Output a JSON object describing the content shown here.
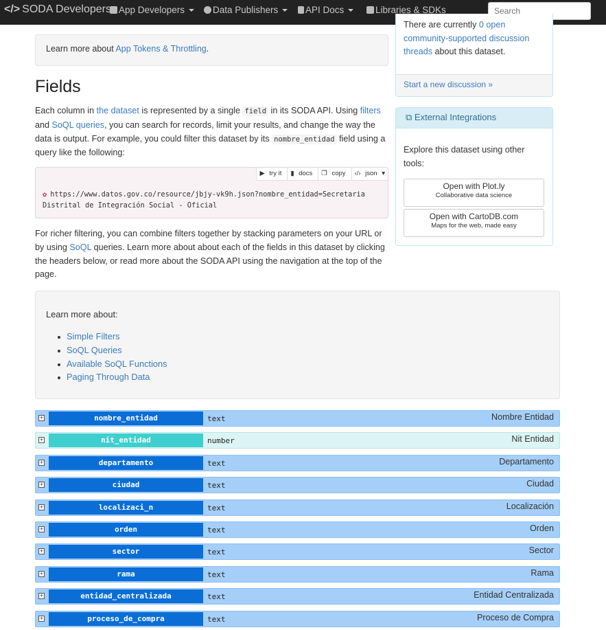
{
  "navbar": {
    "brand": "SODA Developers",
    "brand_code": "</>",
    "items": [
      {
        "label": "App Developers"
      },
      {
        "label": "Data Publishers"
      },
      {
        "label": "API Docs"
      },
      {
        "label": "Libraries & SDKs"
      }
    ],
    "search_placeholder": "Search"
  },
  "tokens_well": {
    "prefix": "Learn more about ",
    "link": "App Tokens & Throttling",
    "suffix": "."
  },
  "fields_section": {
    "title": "Fields",
    "p1": {
      "t1": "Each column in ",
      "l1": "the dataset",
      "t2": " is represented by a single ",
      "code1": "field",
      "t3": " in its SODA API. Using ",
      "l2": "filters",
      "t4": " and ",
      "l3": "SoQL queries",
      "t5": ", you can search for records, limit your results, and change the way the data is output. For example, you could filter this dataset by its ",
      "code2": "nombre_entidad",
      "t6": " field using a query like the following:"
    },
    "code_tools": [
      "try it",
      "docs",
      "copy",
      "json"
    ],
    "code_url_line1": "https://www.datos.gov.co/resource/jbjy-vk9h.json?nombre_entidad=Secretaria",
    "code_url_line2": "Distrital de Integración Social - Oficial",
    "p2": {
      "t1": "For richer filtering, you can combine filters together by stacking parameters on your URL or by using ",
      "l1": "SoQL",
      "t2": " queries. Learn more about about each of the fields in this dataset by clicking the headers below, or read more about the SODA API using the navigation at the top of the page."
    }
  },
  "learn_more": {
    "title": "Learn more about:",
    "links": [
      "Simple Filters",
      "SoQL Queries",
      "Available SoQL Functions",
      "Paging Through Data"
    ]
  },
  "sidebar": {
    "discussion": {
      "t1": "There are currently ",
      "l1": "0 open community-supported discussion threads",
      "t2": " about this dataset.",
      "footer_link": "Start a new discussion »"
    },
    "external": {
      "title": "External Integrations",
      "body": "Explore this dataset using other tools:",
      "buttons": [
        {
          "title": "Open with Plot.ly",
          "subtitle": "Collaborative data science"
        },
        {
          "title": "Open with CartoDB.com",
          "subtitle": "Maps for the web, made easy"
        }
      ]
    }
  },
  "fields": [
    {
      "name": "nombre_entidad",
      "type": "text",
      "label": "Nombre Entidad"
    },
    {
      "name": "nit_entidad",
      "type": "number",
      "label": "Nit Entidad"
    },
    {
      "name": "departamento",
      "type": "text",
      "label": "Departamento"
    },
    {
      "name": "ciudad",
      "type": "text",
      "label": "Ciudad"
    },
    {
      "name": "localizaci_n",
      "type": "text",
      "label": "Localización"
    },
    {
      "name": "orden",
      "type": "text",
      "label": "Orden"
    },
    {
      "name": "sector",
      "type": "text",
      "label": "Sector"
    },
    {
      "name": "rama",
      "type": "text",
      "label": "Rama"
    },
    {
      "name": "entidad_centralizada",
      "type": "text",
      "label": "Entidad Centralizada"
    },
    {
      "name": "proceso_de_compra",
      "type": "text",
      "label": "Proceso de Compra"
    }
  ],
  "colors": {
    "navbar_bg": "#222222",
    "link": "#3a7bbf",
    "field_row_bg": "#a5cff8",
    "field_name_bg": "#0a6ed6",
    "field_row_alt_bg": "#dcf4f4",
    "field_name_alt_bg": "#3fcfcf",
    "code_bg": "#f9f2f4"
  }
}
